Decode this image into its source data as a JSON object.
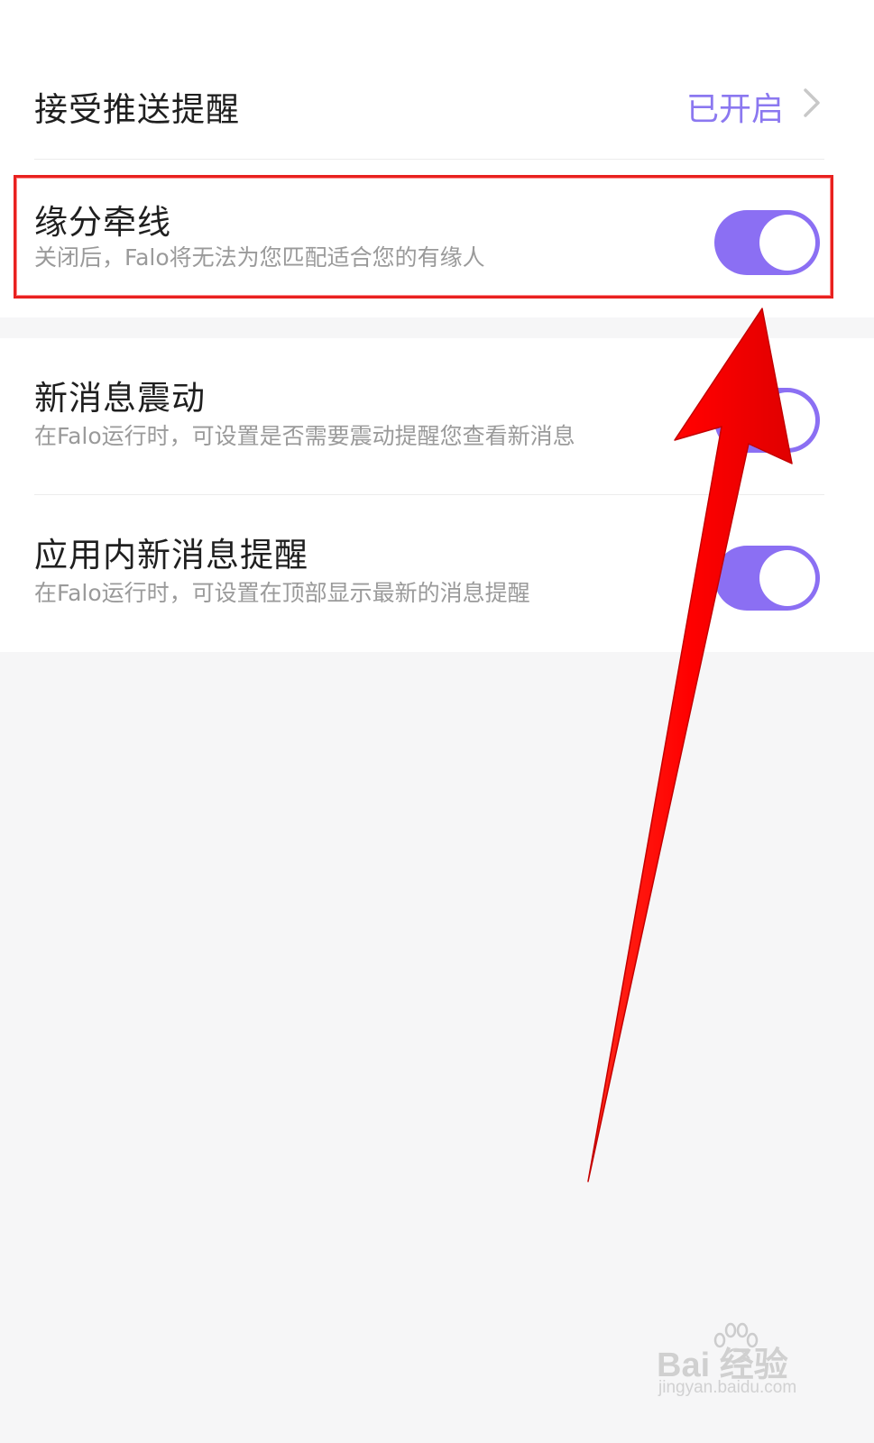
{
  "settings": {
    "push": {
      "title": "接受推送提醒",
      "value": "已开启",
      "chevron_icon": "chevron-right-icon"
    },
    "match_line": {
      "title": "缘分牵线",
      "description": "关闭后，Falo将无法为您匹配适合您的有缘人",
      "enabled": true
    },
    "vibration": {
      "title": "新消息震动",
      "description": "在Falo运行时，可设置是否需要震动提醒您查看新消息",
      "enabled": true
    },
    "in_app": {
      "title": "应用内新消息提醒",
      "description": "在Falo运行时，可设置在顶部显示最新的消息提醒",
      "enabled": true
    }
  },
  "colors": {
    "accent": "#8b6ff3",
    "accent_text": "#8b78f0",
    "annotation": "#ff0000"
  },
  "watermark": {
    "brand": "Bai 经验",
    "url": "jingyan.baidu.com"
  }
}
